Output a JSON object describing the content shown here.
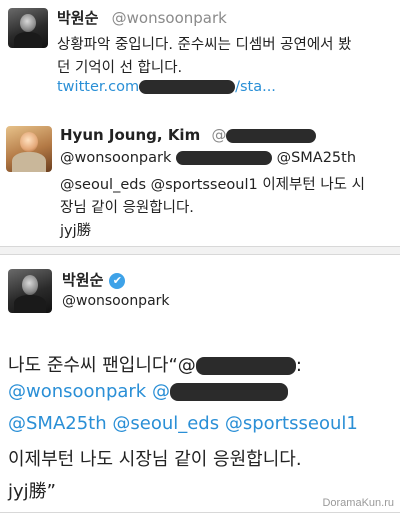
{
  "tweet1": {
    "name": "박원순",
    "handle": "@wonsoonpark",
    "line1": "상황파악 중입니다. 준수씨는 디셈버 공연에서 봤",
    "line2": "던 기억이 선 합니다.",
    "link_start": "twitter.com",
    "link_end": "/sta..."
  },
  "tweet2": {
    "name": "Hyun Joung, Kim",
    "handle_prefix": "@",
    "line1_mention": "@wonsoonpark",
    "line1_mention2": "@SMA25th",
    "line2_mentions": "@seoul_eds @sportsseoul1",
    "line2_text": "이제부턴 나도 시",
    "line3": "장님 같이 응원합니다.",
    "line4": "jyj勝"
  },
  "tweet3": {
    "name": "박원순",
    "handle": "@wonsoonpark",
    "verified_glyph": "✔",
    "line1_text": "나도 준수씨 팬입니다“@",
    "line1_colon": ":",
    "line2_mention": "@wonsoonpark @",
    "line3": "@SMA25th @seoul_eds @sportsseoul1",
    "line4": "이제부턴 나도 시장님 같이 응원합니다.",
    "line5": "jyj勝”"
  },
  "watermark": "DoramaKun.ru",
  "colors": {
    "link": "#2a8fd6",
    "verified": "#3ea2e8"
  }
}
